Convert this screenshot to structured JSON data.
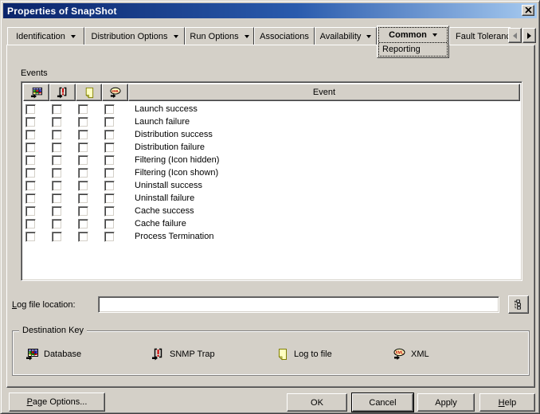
{
  "window": {
    "title": "Properties of SnapShot",
    "close_icon": "close-icon"
  },
  "tabs": [
    {
      "label": "Identification",
      "dropdown": true
    },
    {
      "label": "Distribution Options",
      "dropdown": true
    },
    {
      "label": "Run Options",
      "dropdown": true
    },
    {
      "label": "Associations",
      "dropdown": false
    },
    {
      "label": "Availability",
      "dropdown": true
    },
    {
      "label": "Common",
      "dropdown": true,
      "active": true,
      "subpage": "Reporting"
    },
    {
      "label": "Fault Toleranc",
      "dropdown": false,
      "truncated": true
    }
  ],
  "tab_scroller": {
    "left_icon": "arrow-left-icon",
    "left_enabled": false,
    "right_icon": "arrow-right-icon",
    "right_enabled": true
  },
  "events": {
    "section_label": "Events",
    "header": {
      "event_column": "Event",
      "icon_columns": [
        "database-icon",
        "snmp-trap-icon",
        "log-to-file-icon",
        "xml-icon"
      ]
    },
    "rows": [
      {
        "label": "Launch success",
        "checks": [
          false,
          false,
          false,
          false
        ]
      },
      {
        "label": "Launch failure",
        "checks": [
          false,
          false,
          false,
          false
        ]
      },
      {
        "label": "Distribution success",
        "checks": [
          false,
          false,
          false,
          false
        ]
      },
      {
        "label": "Distribution failure",
        "checks": [
          false,
          false,
          false,
          false
        ]
      },
      {
        "label": "Filtering (Icon hidden)",
        "checks": [
          false,
          false,
          false,
          false
        ]
      },
      {
        "label": "Filtering (Icon shown)",
        "checks": [
          false,
          false,
          false,
          false
        ]
      },
      {
        "label": "Uninstall success",
        "checks": [
          false,
          false,
          false,
          false
        ]
      },
      {
        "label": "Uninstall failure",
        "checks": [
          false,
          false,
          false,
          false
        ]
      },
      {
        "label": "Cache success",
        "checks": [
          false,
          false,
          false,
          false
        ]
      },
      {
        "label": "Cache failure",
        "checks": [
          false,
          false,
          false,
          false
        ]
      },
      {
        "label": "Process Termination",
        "checks": [
          false,
          false,
          false,
          false
        ]
      }
    ]
  },
  "log_file": {
    "label": "Log file location:",
    "value": "",
    "browse_icon": "tree-browse-icon"
  },
  "destination_key": {
    "label": "Destination Key",
    "items": [
      {
        "icon": "database-icon",
        "label": "Database"
      },
      {
        "icon": "snmp-trap-icon",
        "label": "SNMP Trap"
      },
      {
        "icon": "log-to-file-icon",
        "label": "Log to file"
      },
      {
        "icon": "xml-icon",
        "label": "XML"
      }
    ]
  },
  "buttons": {
    "page_options": "Page Options...",
    "ok": "OK",
    "cancel": "Cancel",
    "apply": "Apply",
    "help": "Help"
  },
  "colors": {
    "dialog_bg": "#d4d0c8",
    "titlebar_left": "#0a246a",
    "titlebar_right": "#a6caf0",
    "content_bg": "#ffffff",
    "title_text": "#ffffff"
  }
}
